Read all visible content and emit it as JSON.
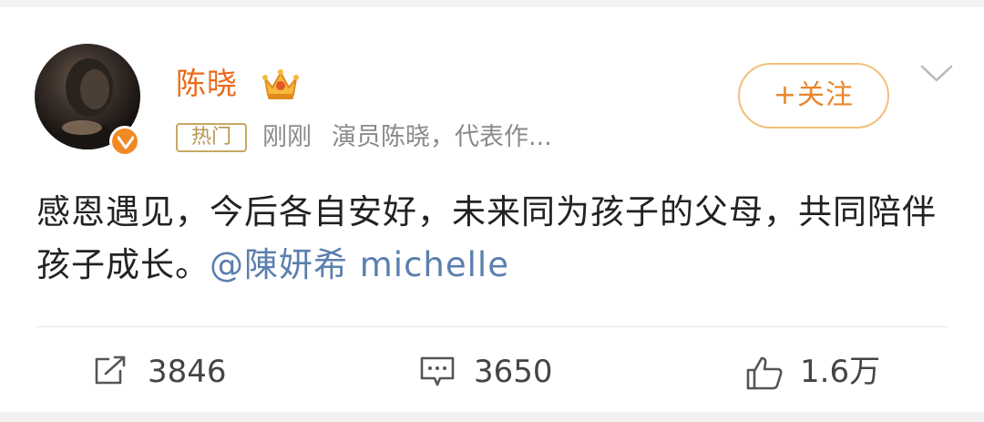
{
  "post": {
    "author": {
      "name": "陈晓",
      "verified": true
    },
    "hot_badge": "热门",
    "time": "刚刚",
    "bio": "演员陈晓，代表作...",
    "follow_label": "+关注",
    "text": "感恩遇见，今后各自安好，未来同为孩子的父母，共同陪伴孩子成长。",
    "mention": "@陳妍希 michelle"
  },
  "actions": {
    "repost_count": "3846",
    "comment_count": "3650",
    "like_count": "1.6万"
  },
  "colors": {
    "username": "#e86a1a",
    "follow_accent": "#e7862a",
    "mention": "#5b7fae",
    "hot_badge": "#b9944a",
    "verify_badge": "#f08a24"
  }
}
